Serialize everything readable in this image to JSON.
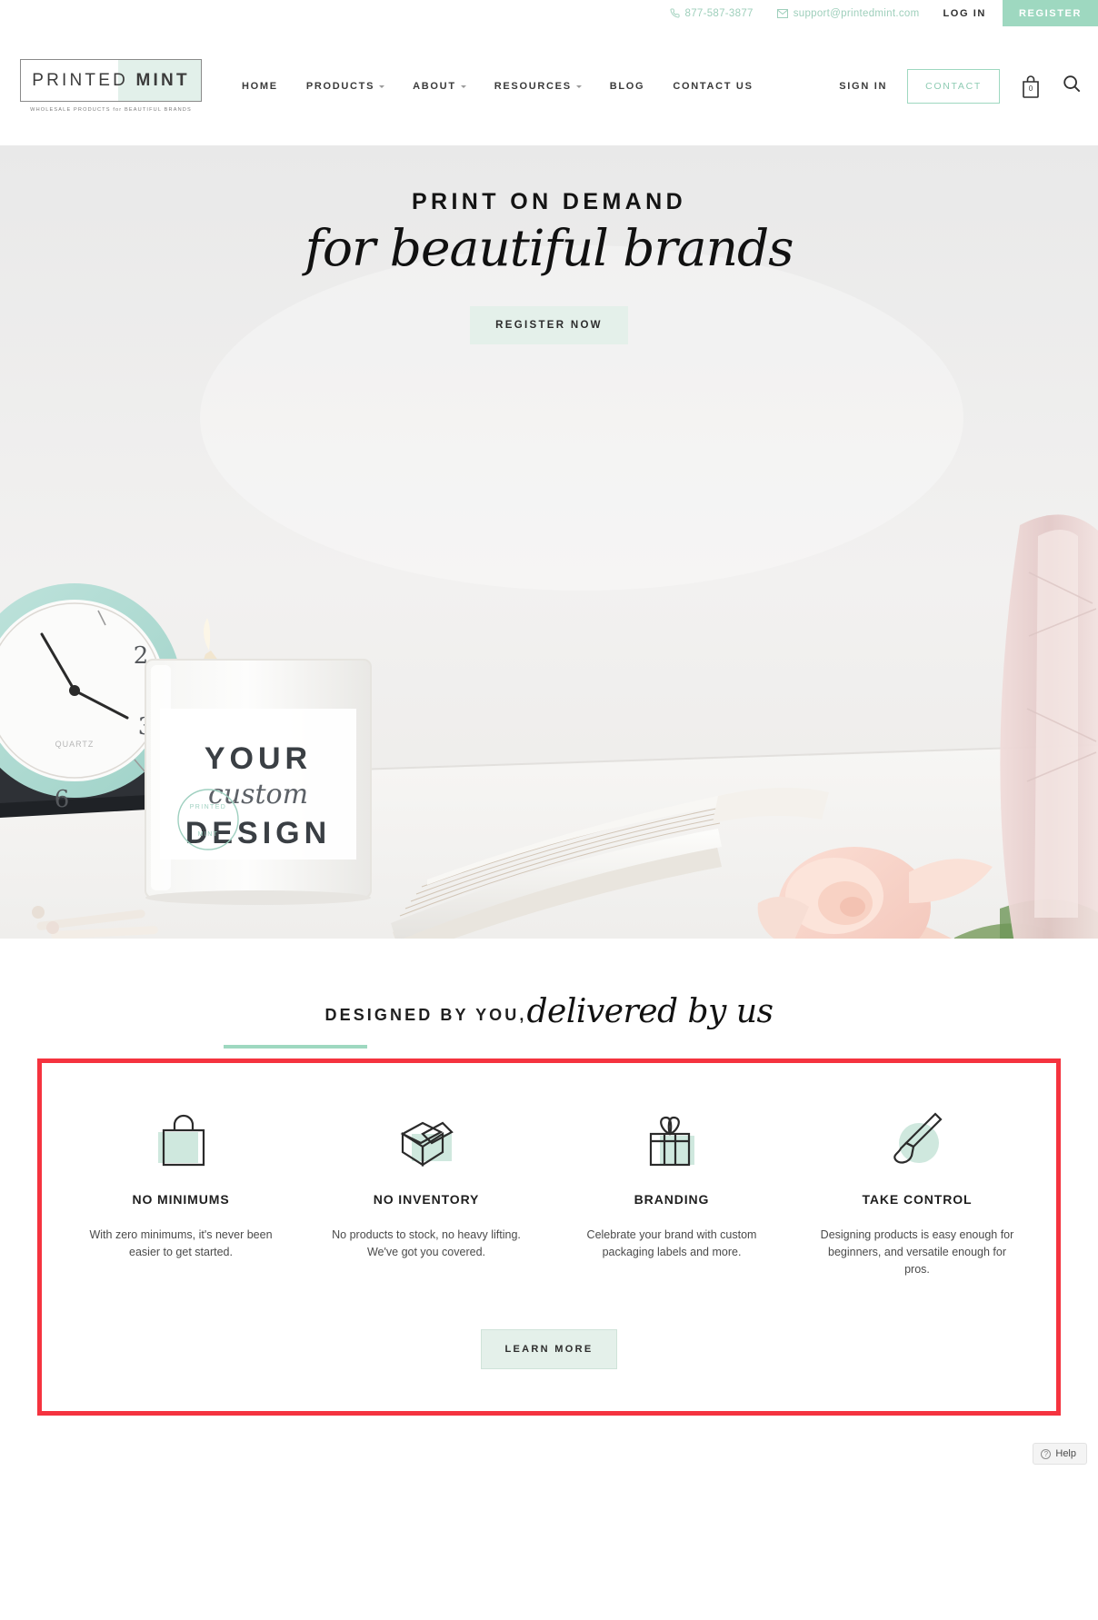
{
  "topbar": {
    "phone": "877-587-3877",
    "email": "support@printedmint.com",
    "login": "LOG IN",
    "register": "REGISTER"
  },
  "header": {
    "logo_word_1": "PRINTED",
    "logo_word_2": "MINT",
    "logo_tagline": "WHOLESALE PRODUCTS for BEAUTIFUL BRANDS",
    "nav": [
      {
        "label": "HOME",
        "has_caret": false
      },
      {
        "label": "PRODUCTS",
        "has_caret": true
      },
      {
        "label": "ABOUT",
        "has_caret": true
      },
      {
        "label": "RESOURCES",
        "has_caret": true
      },
      {
        "label": "BLOG",
        "has_caret": false
      },
      {
        "label": "CONTACT US",
        "has_caret": false
      }
    ],
    "signin": "SIGN IN",
    "contact_button": "CONTACT",
    "cart_count": "0"
  },
  "hero": {
    "kicker": "PRINT ON DEMAND",
    "script": "for beautiful brands",
    "cta": "REGISTER NOW",
    "product_label_top": "YOUR",
    "product_label_script": "custom",
    "product_label_bottom": "DESIGN",
    "seal_top": "PRINTED",
    "seal_bottom": "MINT"
  },
  "section2": {
    "title_bold": "DESIGNED BY YOU,",
    "title_script": "delivered by us",
    "features": [
      {
        "icon": "shopping-bag-icon",
        "title": "NO MINIMUMS",
        "body": "With zero minimums, it's never been easier to get started."
      },
      {
        "icon": "open-box-icon",
        "title": "NO INVENTORY",
        "body": "No products to stock, no heavy lifting. We've got you covered."
      },
      {
        "icon": "gift-icon",
        "title": "BRANDING",
        "body": "Celebrate your brand with custom packaging labels and more."
      },
      {
        "icon": "paintbrush-icon",
        "title": "TAKE CONTROL",
        "body": "Designing products is easy enough for beginners, and versatile enough for pros."
      }
    ],
    "learn_more": "LEARN MORE"
  },
  "widget": {
    "help_label": "Help"
  },
  "colors": {
    "mint": "#9ed8c0",
    "mint_light": "#e4f0ea",
    "highlight_red": "#f5333f",
    "text_dark": "#1e1e1e"
  }
}
